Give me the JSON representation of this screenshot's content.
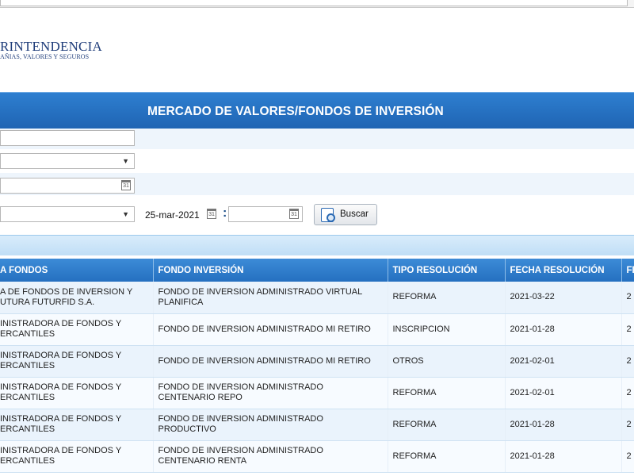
{
  "logo": {
    "line1": "RINTENDENCIA",
    "line2": "AÑIAS, VALORES Y SEGUROS"
  },
  "banner": {
    "title": "MERCADO DE VALORES/FONDOS DE INVERSIÓN"
  },
  "filters": {
    "date_from": "25-mar-2021",
    "date_separator": ":",
    "search_button": "Buscar"
  },
  "table": {
    "headers": [
      "A FONDOS",
      "FONDO INVERSIÓN",
      "TIPO RESOLUCIÓN",
      "FECHA RESOLUCIÓN",
      "FI"
    ],
    "rows": [
      {
        "admin": "A DE FONDOS DE INVERSION Y UTURA FUTURFID S.A.",
        "fondo": "FONDO DE INVERSION ADMINISTRADO VIRTUAL PLANIFICA",
        "tipo": "REFORMA",
        "fecha": "2021-03-22",
        "last": "2"
      },
      {
        "admin": "INISTRADORA DE FONDOS Y ERCANTILES",
        "fondo": "FONDO DE INVERSION ADMINISTRADO MI RETIRO",
        "tipo": "INSCRIPCION",
        "fecha": "2021-01-28",
        "last": "2"
      },
      {
        "admin": "INISTRADORA DE FONDOS Y ERCANTILES",
        "fondo": "FONDO DE INVERSION ADMINISTRADO MI RETIRO",
        "tipo": "OTROS",
        "fecha": "2021-02-01",
        "last": "2"
      },
      {
        "admin": "INISTRADORA DE FONDOS Y ERCANTILES",
        "fondo": "FONDO DE INVERSION ADMINISTRADO CENTENARIO REPO",
        "tipo": "REFORMA",
        "fecha": "2021-02-01",
        "last": "2"
      },
      {
        "admin": "INISTRADORA DE FONDOS Y ERCANTILES",
        "fondo": "FONDO DE INVERSION ADMINISTRADO PRODUCTIVO",
        "tipo": "REFORMA",
        "fecha": "2021-01-28",
        "last": "2"
      },
      {
        "admin": "INISTRADORA DE FONDOS Y ERCANTILES",
        "fondo": "FONDO DE INVERSION ADMINISTRADO CENTENARIO RENTA",
        "tipo": "REFORMA",
        "fecha": "2021-01-28",
        "last": "2"
      }
    ]
  }
}
